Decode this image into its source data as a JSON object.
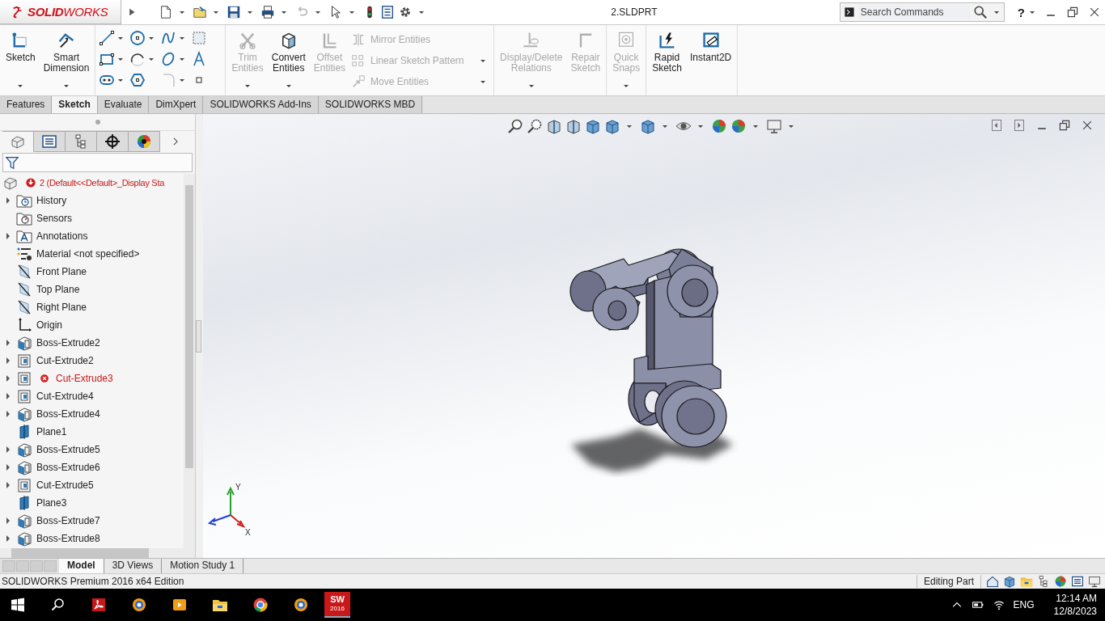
{
  "title_bar": {
    "logo": "**SOLID**WORKS",
    "title": "2.SLDPRT",
    "search": {
      "placeholder": "Search Commands"
    },
    "help": "?"
  },
  "ribbon": [
    {
      "items": [
        {
          "kind": "large",
          "label": "Sketch",
          "disabled": false,
          "dropdown": true
        },
        {
          "kind": "large",
          "label": "Smart Dimension",
          "disabled": false,
          "dropdown": true
        }
      ]
    },
    {
      "items": [
        {
          "kind": "grid",
          "tools": [
            {
              "disabled": false,
              "dropdown": true
            },
            {
              "disabled": false,
              "dropdown": true
            },
            {
              "disabled": false,
              "dropdown": true
            },
            {
              "disabled": false,
              "dropdown": false
            },
            {
              "disabled": false,
              "dropdown": true
            },
            {
              "disabled": false,
              "dropdown": true
            },
            {
              "disabled": false,
              "dropdown": true
            },
            {
              "disabled": false,
              "dropdown": false
            },
            {
              "disabled": false,
              "dropdown": true
            },
            {
              "disabled": false,
              "dropdown": false
            },
            {
              "disabled": true,
              "dropdown": true
            },
            {
              "disabled": false,
              "dropdown": false
            }
          ]
        }
      ]
    },
    {
      "items": [
        {
          "kind": "large",
          "label": "Trim Entities",
          "disabled": true,
          "dropdown": true
        },
        {
          "kind": "large",
          "label": "Convert Entities",
          "disabled": false,
          "dropdown": true
        },
        {
          "kind": "large",
          "label": "Offset Entities",
          "disabled": true,
          "dropdown": false
        },
        {
          "kind": "list",
          "rows": [
            {
              "label": "Mirror Entities",
              "disabled": true,
              "dropdown": false
            },
            {
              "label": "Linear Sketch Pattern",
              "disabled": true,
              "dropdown": true
            },
            {
              "label": "Move Entities",
              "disabled": true,
              "dropdown": true
            }
          ]
        }
      ]
    },
    {
      "items": [
        {
          "kind": "large",
          "label": "Display/Delete Relations",
          "disabled": true,
          "dropdown": true
        },
        {
          "kind": "large",
          "label": "Repair Sketch",
          "disabled": true,
          "dropdown": false
        }
      ]
    },
    {
      "items": [
        {
          "kind": "large",
          "label": "Quick Snaps",
          "disabled": true,
          "dropdown": true
        }
      ]
    },
    {
      "items": [
        {
          "kind": "large",
          "label": "Rapid Sketch",
          "disabled": false,
          "dropdown": false
        },
        {
          "kind": "large",
          "label": "Instant2D",
          "disabled": false,
          "dropdown": false
        }
      ]
    }
  ],
  "command_tabs": [
    {
      "label": "Features",
      "selected": false
    },
    {
      "label": "Sketch",
      "selected": true
    },
    {
      "label": "Evaluate",
      "selected": false
    },
    {
      "label": "DimXpert",
      "selected": false
    },
    {
      "label": "SOLIDWORKS Add-Ins",
      "selected": false
    },
    {
      "label": "SOLIDWORKS MBD",
      "selected": false
    }
  ],
  "feature_manager": {
    "tabs": [
      {
        "selected": true
      },
      {
        "selected": false
      },
      {
        "selected": false
      },
      {
        "selected": false
      },
      {
        "selected": false
      }
    ],
    "root": {
      "label": "2  (Default<<Default>_Display Sta",
      "error": true
    },
    "items": [
      {
        "kind": "history",
        "label": "History",
        "has_children": true,
        "error": false
      },
      {
        "kind": "sensors",
        "label": "Sensors",
        "has_children": false,
        "error": false
      },
      {
        "kind": "annotations",
        "label": "Annotations",
        "has_children": true,
        "error": false
      },
      {
        "kind": "material",
        "label": "Material <not specified>",
        "has_children": false,
        "error": false
      },
      {
        "kind": "plane",
        "label": "Front Plane",
        "has_children": false,
        "error": false
      },
      {
        "kind": "plane",
        "label": "Top Plane",
        "has_children": false,
        "error": false
      },
      {
        "kind": "plane",
        "label": "Right Plane",
        "has_children": false,
        "error": false
      },
      {
        "kind": "origin",
        "label": "Origin",
        "has_children": false,
        "error": false
      },
      {
        "kind": "boss",
        "label": "Boss-Extrude2",
        "has_children": true,
        "error": false
      },
      {
        "kind": "cut",
        "label": "Cut-Extrude2",
        "has_children": true,
        "error": false
      },
      {
        "kind": "cut",
        "label": "Cut-Extrude3",
        "has_children": true,
        "error": true
      },
      {
        "kind": "cut",
        "label": "Cut-Extrude4",
        "has_children": true,
        "error": false
      },
      {
        "kind": "boss",
        "label": "Boss-Extrude4",
        "has_children": true,
        "error": false
      },
      {
        "kind": "ref-plane",
        "label": "Plane1",
        "has_children": false,
        "error": false
      },
      {
        "kind": "boss",
        "label": "Boss-Extrude5",
        "has_children": true,
        "error": false
      },
      {
        "kind": "boss",
        "label": "Boss-Extrude6",
        "has_children": true,
        "error": false
      },
      {
        "kind": "cut",
        "label": "Cut-Extrude5",
        "has_children": true,
        "error": false
      },
      {
        "kind": "ref-plane",
        "label": "Plane3",
        "has_children": false,
        "error": false
      },
      {
        "kind": "boss",
        "label": "Boss-Extrude7",
        "has_children": true,
        "error": false
      },
      {
        "kind": "boss",
        "label": "Boss-Extrude8",
        "has_children": true,
        "error": false
      }
    ]
  },
  "viewport": {
    "triad": {
      "y": "Y",
      "x": "X"
    }
  },
  "bottom_tabs": [
    {
      "label": "Model",
      "selected": true
    },
    {
      "label": "3D Views",
      "selected": false
    },
    {
      "label": "Motion Study 1",
      "selected": false
    }
  ],
  "status_bar": {
    "product": "SOLIDWORKS Premium 2016 x64 Edition",
    "mode": "Editing Part"
  },
  "taskbar": {
    "sw_badge": {
      "mark": "SW",
      "year": "2016"
    },
    "language": "ENG",
    "time": "12:14 AM",
    "date": "12/8/2023"
  }
}
